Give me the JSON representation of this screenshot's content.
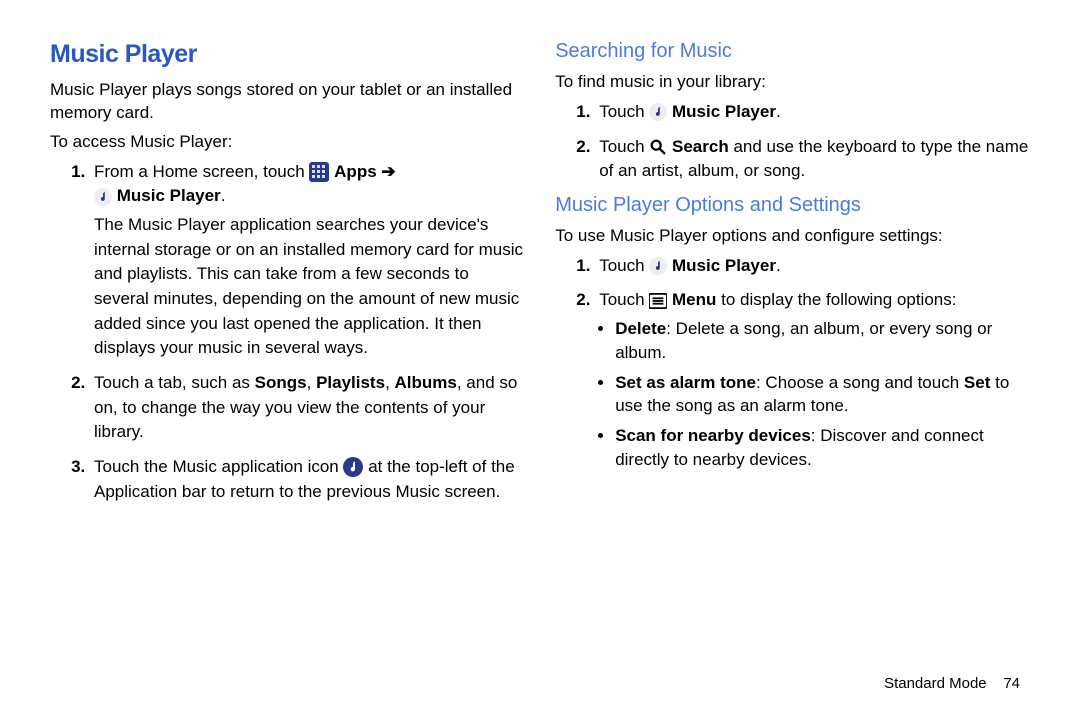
{
  "left": {
    "title": "Music Player",
    "intro": "Music Player plays songs stored on your tablet or an installed memory card.",
    "access_lead": "To access Music Player:",
    "step1": {
      "pre": "From a Home screen, touch ",
      "apps_label": "Apps",
      "arrow": " ➔ ",
      "mp_label": "Music Player",
      "period": ".",
      "desc": "The Music Player application searches your device's internal storage or on an installed memory card for music and playlists. This can take from a few seconds to several minutes, depending on the amount of new music added since you last opened the application. It then displays your music in several ways."
    },
    "step2": {
      "pre": "Touch a tab, such as ",
      "songs": "Songs",
      "c1": ", ",
      "playlists": "Playlists",
      "c2": ", ",
      "albums": "Albums",
      "tail": ", and so on, to change the way you view the contents of your library."
    },
    "step3": {
      "pre": "Touch the Music application icon ",
      "tail": " at the top-left of the Application bar to return to the previous Music screen."
    }
  },
  "right": {
    "search_head": "Searching for Music",
    "search_lead": "To find music in your library:",
    "s_step1": {
      "pre": "Touch ",
      "mp": "Music Player",
      "period": "."
    },
    "s_step2": {
      "pre": "Touch ",
      "search_label": "Search",
      "tail": " and use the keyboard to type the name of an artist, album, or song."
    },
    "opts_head": "Music Player Options and Settings",
    "opts_lead": "To use Music Player options and configure settings:",
    "o_step1": {
      "pre": "Touch ",
      "mp": "Music Player",
      "period": "."
    },
    "o_step2": {
      "pre": "Touch ",
      "menu_label": "Menu",
      "tail": " to display the following options:"
    },
    "bullets": {
      "b1": {
        "name": "Delete",
        "desc": ": Delete a song, an album, or every song or album."
      },
      "b2": {
        "name": "Set as alarm tone",
        "mid": ": Choose a song and touch ",
        "set": "Set",
        "tail": " to use the song as an alarm tone."
      },
      "b3": {
        "name": "Scan for nearby devices",
        "desc": ": Discover and connect directly to nearby devices."
      }
    }
  },
  "footer": {
    "mode": "Standard Mode",
    "page": "74"
  }
}
